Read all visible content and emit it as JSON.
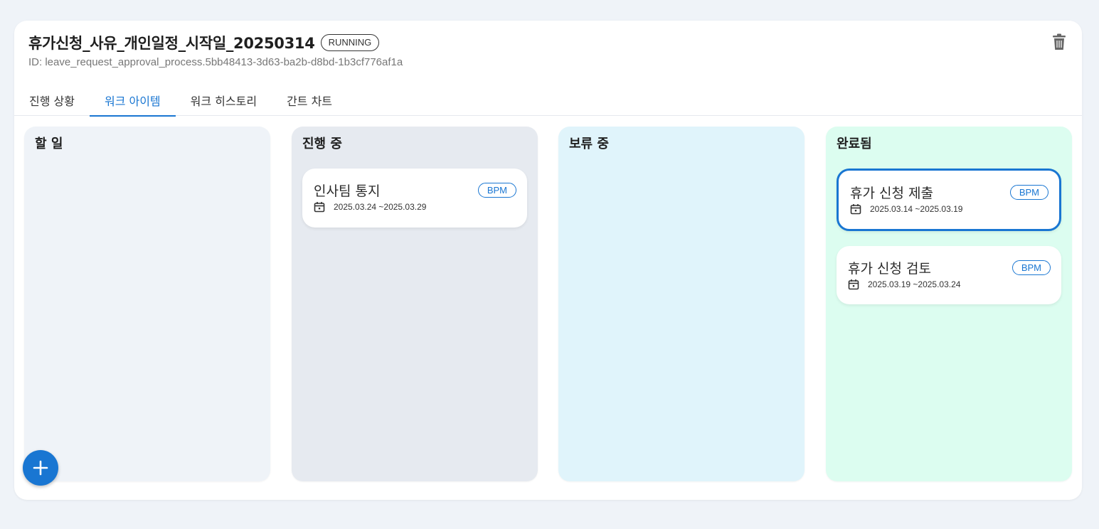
{
  "instance": {
    "title": "휴가신청_사유_개인일정_시작일_20250314",
    "status": "RUNNING",
    "id_text": "ID: leave_request_approval_process.5bb48413-3d63-ba2b-d8bd-1b3cf776af1a"
  },
  "icons": {
    "delete": "trash-icon",
    "calendar": "calendar-icon",
    "add": "plus-icon"
  },
  "tabs": [
    {
      "label": "진행 상황",
      "active": false
    },
    {
      "label": "워크 아이템",
      "active": true
    },
    {
      "label": "워크 히스토리",
      "active": false
    },
    {
      "label": "간트 차트",
      "active": false
    }
  ],
  "colors": {
    "accent": "#1976d2",
    "todo_bg": "#eff3f8",
    "in_progress_bg": "#e6eaf0",
    "pending_bg": "#e0f4fb",
    "done_bg": "#dcfdf0"
  },
  "columns": [
    {
      "title": "할 일",
      "items": []
    },
    {
      "title": "진행 중",
      "items": [
        {
          "name": "인사팀 통지",
          "badge": "BPM",
          "date": "2025.03.24 ~2025.03.29"
        }
      ]
    },
    {
      "title": "보류 중",
      "items": []
    },
    {
      "title": "완료됨",
      "items": [
        {
          "name": "휴가 신청 제출",
          "badge": "BPM",
          "date": "2025.03.14 ~2025.03.19",
          "selected": true
        },
        {
          "name": "휴가 신청 검토",
          "badge": "BPM",
          "date": "2025.03.19 ~2025.03.24"
        }
      ]
    }
  ]
}
